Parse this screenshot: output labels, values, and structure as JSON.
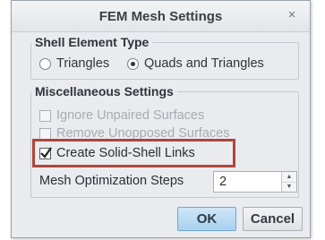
{
  "dialog": {
    "title": "FEM Mesh Settings",
    "close_glyph": "×"
  },
  "shell_group": {
    "legend": "Shell Element Type",
    "options": [
      {
        "label": "Triangles",
        "selected": false
      },
      {
        "label": "Quads and Triangles",
        "selected": true
      }
    ]
  },
  "misc_group": {
    "legend": "Miscellaneous Settings",
    "ignore_unpaired": {
      "label": "Ignore Unpaired Surfaces",
      "checked": false,
      "enabled": false
    },
    "remove_unopposed": {
      "label": "Remove Unopposed Surfaces",
      "checked": false,
      "enabled": false
    },
    "create_links": {
      "label": "Create Solid-Shell Links",
      "checked": true,
      "enabled": true
    }
  },
  "mesh_steps": {
    "label": "Mesh Optimization Steps",
    "value": "2"
  },
  "buttons": {
    "ok": "OK",
    "cancel": "Cancel"
  },
  "colors": {
    "highlight_box": "#b0453a",
    "ok_button": "#a9d1f0"
  }
}
